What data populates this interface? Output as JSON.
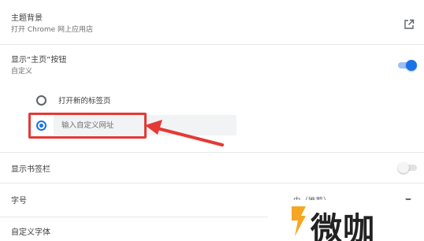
{
  "theme": {
    "title": "主题背景",
    "subtitle": "打开 Chrome 网上应用店",
    "icon": "open-in-new-icon"
  },
  "home_button": {
    "title": "显示“主页”按钮",
    "subtitle": "自定义",
    "toggle_on": true,
    "options": [
      {
        "label": "打开新的标签页",
        "selected": false
      },
      {
        "label": "",
        "selected": true
      }
    ],
    "url_placeholder": "输入自定义网址"
  },
  "bookmarks_bar": {
    "title": "显示书签栏",
    "toggle_on": false
  },
  "font_size": {
    "title": "字号",
    "selected_value": "中（推荐）",
    "icon": "chevron-down-icon"
  },
  "custom_fonts": {
    "title": "自定义字体"
  },
  "annotation": {
    "box_color": "#e53935",
    "arrow_color": "#e53935"
  },
  "accent_color": "#1a73e8",
  "watermark": {
    "text": "微咖"
  }
}
